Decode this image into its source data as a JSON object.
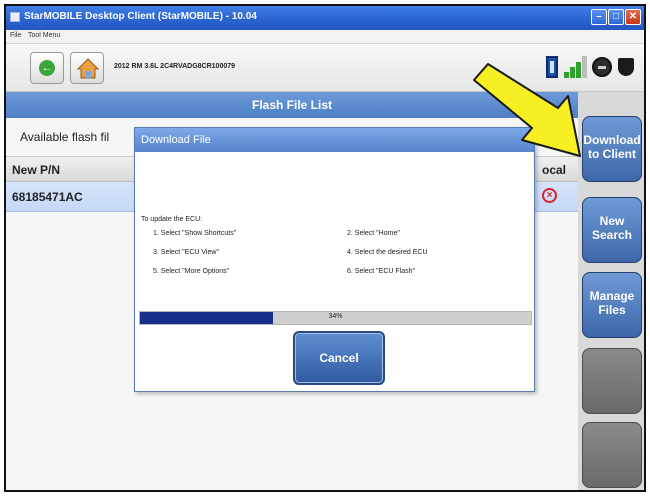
{
  "window": {
    "title": "StarMOBILE Desktop Client (StarMOBILE) - 10.04",
    "min": "–",
    "max": "□",
    "close": "✕"
  },
  "menu": [
    "File",
    "Tool Menu"
  ],
  "toolbar": {
    "vehicle": "2012  RM  3.6L  2C4RVADG8CR100079"
  },
  "header": {
    "title": "Flash File List"
  },
  "list": {
    "available_label": "Available flash fil",
    "columns": {
      "pn": "New P/N",
      "local": "ocal"
    },
    "rows": [
      {
        "pn": "68185471AC"
      }
    ]
  },
  "side_buttons": [
    {
      "label": "Download to Client"
    },
    {
      "label": "New Search"
    },
    {
      "label": "Manage Files"
    },
    {
      "label": ""
    },
    {
      "label": ""
    }
  ],
  "dialog": {
    "title": "Download File",
    "intro": "To update the ECU:",
    "steps": [
      "1. Select \"Show Shortcuts\"",
      "2. Select \"Home\"",
      "3. Select \"ECU View\"",
      "4. Select the desired ECU",
      "5. Select \"More Options\"",
      "6. Select \"ECU Flash\""
    ],
    "progress_text": "34%",
    "progress_value": 0.34,
    "cancel": "Cancel"
  },
  "colors": {
    "arrow": "#f5ef23",
    "header": "#5a88cc",
    "side_button": "#4d78b8",
    "progress": "#142e8a",
    "error": "#d9222a"
  },
  "icons": [
    "back-icon",
    "home-icon",
    "battery-icon",
    "signal-icon",
    "connection-icon",
    "plug-icon",
    "error-icon",
    "pointer-arrow-icon"
  ]
}
